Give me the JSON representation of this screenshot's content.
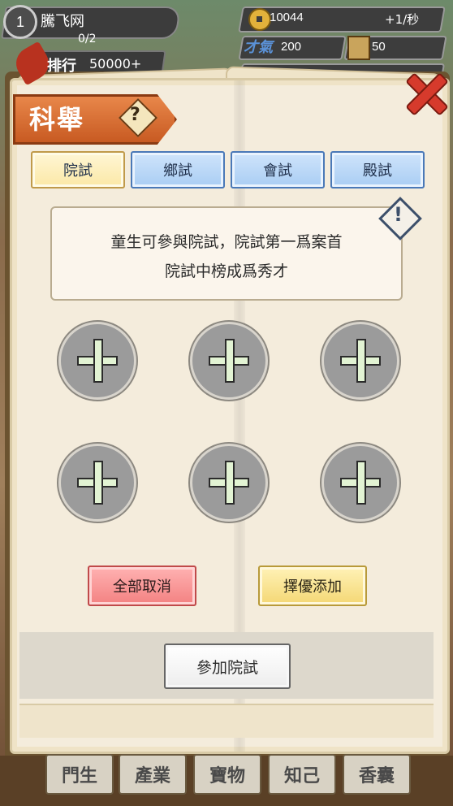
{
  "hud": {
    "level": "1",
    "player_name": "騰飞网",
    "exp": "0/2",
    "rank_label": "排行",
    "rank_value": "50000+",
    "coins": "10044",
    "coin_rate": "+1/秒",
    "talent_icon_text": "才氣",
    "talent_value": "200",
    "book_value": "50"
  },
  "panel": {
    "title": "科舉",
    "help_symbol": "?",
    "tabs": [
      {
        "label": "院試",
        "active": true
      },
      {
        "label": "鄉試",
        "active": false
      },
      {
        "label": "會試",
        "active": false
      },
      {
        "label": "殿試",
        "active": false
      }
    ],
    "description_lines": [
      "童生可參與院試，院試第一爲案首",
      "院試中榜成爲秀才"
    ],
    "alert_symbol": "!",
    "slots_count": 6,
    "cancel_all_label": "全部取消",
    "auto_add_label": "擇優添加",
    "join_exam_label": "參加院試"
  },
  "bottom_nav": [
    {
      "label": "門生"
    },
    {
      "label": "產業"
    },
    {
      "label": "寶物"
    },
    {
      "label": "知己"
    },
    {
      "label": "香囊"
    }
  ]
}
